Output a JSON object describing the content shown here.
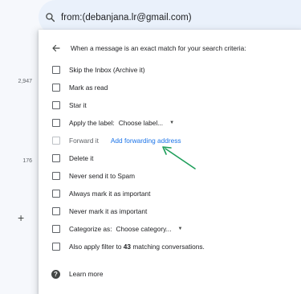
{
  "gutter": {
    "counts": [
      "2,947",
      "176"
    ],
    "compose_icon": "plus-icon"
  },
  "search": {
    "icon": "search-icon",
    "query": "from:(debanjana.lr@gmail.com)"
  },
  "filter": {
    "back_icon": "arrow-back-icon",
    "heading": "When a message is an exact match for your search criteria:",
    "options": {
      "skip_inbox": "Skip the Inbox (Archive it)",
      "mark_read": "Mark as read",
      "star": "Star it",
      "apply_label": "Apply the label:",
      "label_select": "Choose label...",
      "forward": "Forward it",
      "forward_link": "Add forwarding address",
      "delete": "Delete it",
      "never_spam": "Never send it to Spam",
      "always_important": "Always mark it as important",
      "never_important": "Never mark it as important",
      "categorize": "Categorize as:",
      "category_select": "Choose category...",
      "also_apply_prefix": "Also apply filter to",
      "also_apply_count": "43",
      "also_apply_suffix": "matching conversations."
    },
    "learn_more": "Learn more",
    "help_icon": "help-icon"
  },
  "colors": {
    "link": "#1a73e8",
    "annotation_arrow": "#1e9e5a",
    "searchbar_bg": "#eaf1fb"
  }
}
